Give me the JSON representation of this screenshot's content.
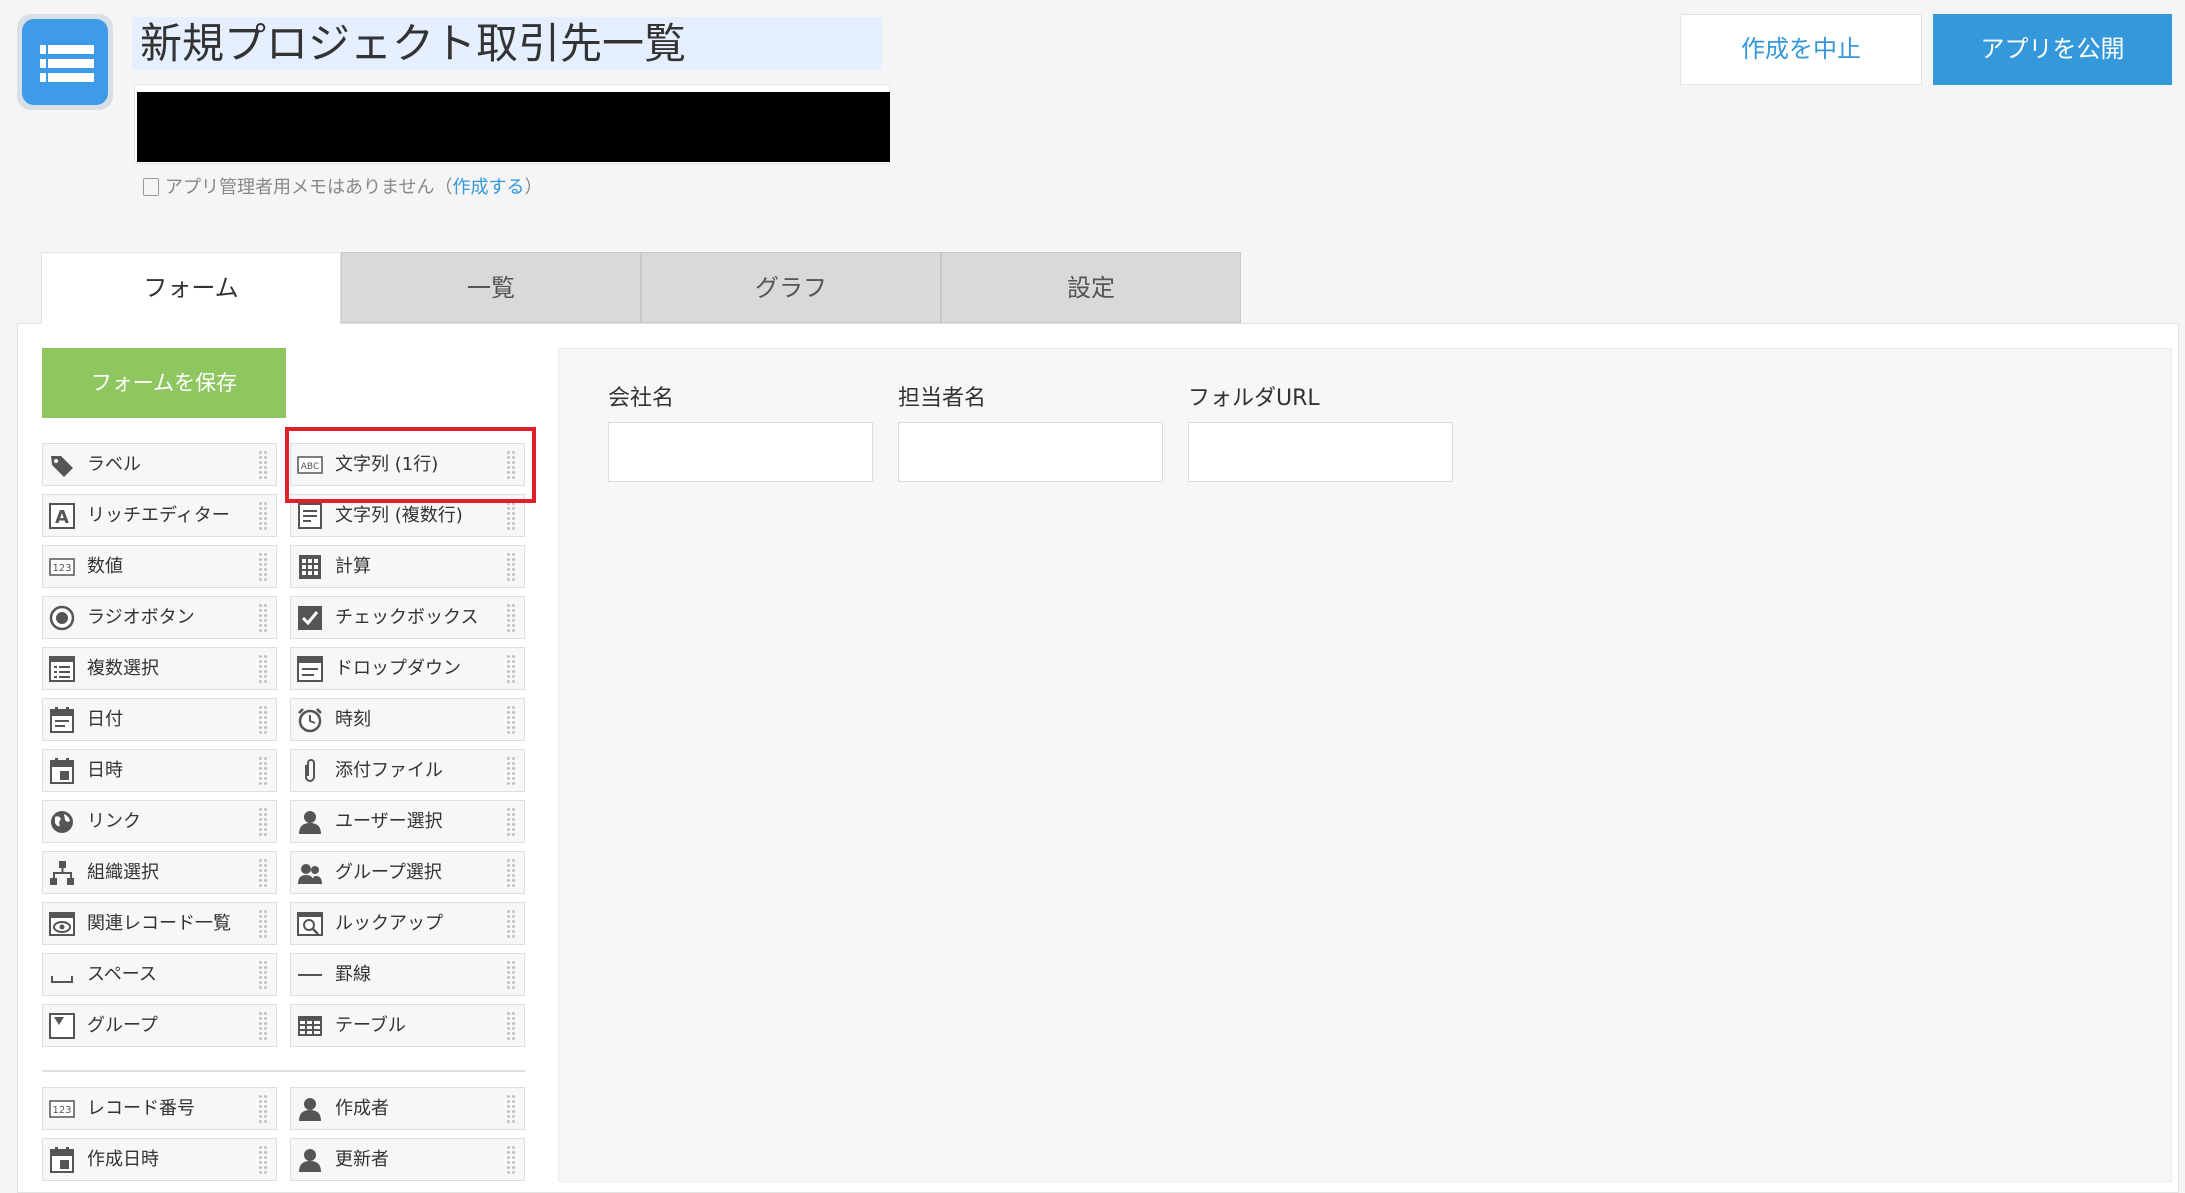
{
  "app": {
    "name": "新規プロジェクト取引先一覧",
    "memo_text": "アプリ管理者用メモはありません（",
    "memo_link": "作成する",
    "memo_close": "）"
  },
  "header": {
    "cancel_label": "作成を中止",
    "publish_label": "アプリを公開"
  },
  "tabs": [
    {
      "label": "フォーム",
      "active": true
    },
    {
      "label": "一覧",
      "active": false
    },
    {
      "label": "グラフ",
      "active": false
    },
    {
      "label": "設定",
      "active": false
    }
  ],
  "save_form_label": "フォームを保存",
  "palette": [
    {
      "label": "ラベル",
      "icon": "tag-icon"
    },
    {
      "label": "文字列 (1行)",
      "icon": "abc-icon",
      "highlighted": true
    },
    {
      "label": "リッチエディター",
      "icon": "rich-text-icon"
    },
    {
      "label": "文字列 (複数行)",
      "icon": "multiline-text-icon"
    },
    {
      "label": "数値",
      "icon": "number-icon"
    },
    {
      "label": "計算",
      "icon": "calculator-icon"
    },
    {
      "label": "ラジオボタン",
      "icon": "radio-icon"
    },
    {
      "label": "チェックボックス",
      "icon": "checkbox-icon"
    },
    {
      "label": "複数選択",
      "icon": "multi-select-icon"
    },
    {
      "label": "ドロップダウン",
      "icon": "dropdown-icon"
    },
    {
      "label": "日付",
      "icon": "calendar-icon"
    },
    {
      "label": "時刻",
      "icon": "clock-icon"
    },
    {
      "label": "日時",
      "icon": "datetime-icon"
    },
    {
      "label": "添付ファイル",
      "icon": "paperclip-icon"
    },
    {
      "label": "リンク",
      "icon": "globe-icon"
    },
    {
      "label": "ユーザー選択",
      "icon": "user-icon"
    },
    {
      "label": "組織選択",
      "icon": "org-icon"
    },
    {
      "label": "グループ選択",
      "icon": "group-icon"
    },
    {
      "label": "関連レコード一覧",
      "icon": "related-records-icon"
    },
    {
      "label": "ルックアップ",
      "icon": "lookup-icon"
    },
    {
      "label": "スペース",
      "icon": "space-icon"
    },
    {
      "label": "罫線",
      "icon": "line-icon"
    },
    {
      "label": "グループ",
      "icon": "group-folder-icon"
    },
    {
      "label": "テーブル",
      "icon": "table-icon"
    }
  ],
  "system_fields": [
    {
      "label": "レコード番号",
      "icon": "record-number-icon"
    },
    {
      "label": "作成者",
      "icon": "user-icon"
    },
    {
      "label": "作成日時",
      "icon": "datetime-icon"
    },
    {
      "label": "更新者",
      "icon": "user-icon"
    }
  ],
  "form_fields": [
    {
      "label": "会社名"
    },
    {
      "label": "担当者名"
    },
    {
      "label": "フォルダURL"
    }
  ],
  "colors": {
    "accent": "#3498db",
    "save": "#8ec760",
    "highlight": "#e0202a"
  }
}
